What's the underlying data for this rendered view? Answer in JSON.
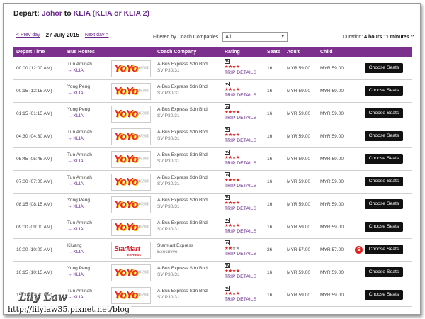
{
  "header": {
    "prefix": "Depart:",
    "origin": "Johor",
    "to": "to",
    "destination": "KLIA (KLIA or KLIA 2)"
  },
  "nav": {
    "prev": "< Prev day",
    "date": "27 July 2015",
    "next": "Next day >"
  },
  "filter": {
    "label": "Filtered by Coach Companies",
    "value": "All"
  },
  "duration": {
    "label": "Duration:",
    "value": "4 hours 11 minutes",
    "suffix": "**"
  },
  "columns": {
    "depart": "Depart Time",
    "routes": "Bus Routes",
    "company": "Coach Company",
    "rating": "Rating",
    "seats": "Seats",
    "adult": "Adult",
    "child": "Child"
  },
  "rows": [
    {
      "time": "00:00 (12:00 AM)",
      "from": "Tun Aminah",
      "to": "→ KLIA",
      "logo": "yoyo",
      "company": "A-Bus Express Sdn Bhd",
      "sub": "SVIP30/31",
      "stars": 4,
      "trip": "TRIP DETAILS",
      "seats": "16",
      "adult": "MYR 59.00",
      "child": "MYR 59.00",
      "badge": "",
      "button": "Choose Seats"
    },
    {
      "time": "00:15 (12:15 AM)",
      "from": "Yong Peng",
      "to": "→ KLIA",
      "logo": "yoyo",
      "company": "A-Bus Express Sdn Bhd",
      "sub": "SVIP30/31",
      "stars": 4,
      "trip": "TRIP DETAILS",
      "seats": "16",
      "adult": "MYR 59.00",
      "child": "MYR 59.00",
      "badge": "",
      "button": "Choose Seats"
    },
    {
      "time": "01:15 (01:15 AM)",
      "from": "Yong Peng",
      "to": "→ KLIA",
      "logo": "yoyo",
      "company": "A-Bus Express Sdn Bhd",
      "sub": "SVIP30/31",
      "stars": 4,
      "trip": "TRIP DETAILS",
      "seats": "16",
      "adult": "MYR 59.00",
      "child": "MYR 59.00",
      "badge": "",
      "button": "Choose Seats"
    },
    {
      "time": "04:30 (04:30 AM)",
      "from": "Tun Aminah",
      "to": "→ KLIA",
      "logo": "yoyo",
      "company": "A-Bus Express Sdn Bhd",
      "sub": "SVIP30/31",
      "stars": 4,
      "trip": "TRIP DETAILS",
      "seats": "16",
      "adult": "MYR 59.00",
      "child": "MYR 59.00",
      "badge": "",
      "button": "Choose Seats"
    },
    {
      "time": "05:45 (05:45 AM)",
      "from": "Tun Aminah",
      "to": "→ KLIA",
      "logo": "yoyo",
      "company": "A-Bus Express Sdn Bhd",
      "sub": "SVIP30/31",
      "stars": 4,
      "trip": "TRIP DETAILS",
      "seats": "16",
      "adult": "MYR 59.00",
      "child": "MYR 59.00",
      "badge": "",
      "button": "Choose Seats"
    },
    {
      "time": "07:00 (07:00 AM)",
      "from": "Tun Aminah",
      "to": "→ KLIA",
      "logo": "yoyo",
      "company": "A-Bus Express Sdn Bhd",
      "sub": "SVIP30/31",
      "stars": 4,
      "trip": "TRIP DETAILS",
      "seats": "16",
      "adult": "MYR 59.00",
      "child": "MYR 59.00",
      "badge": "",
      "button": "Choose Seats"
    },
    {
      "time": "08:15 (08:15 AM)",
      "from": "Yong Peng",
      "to": "→ KLIA",
      "logo": "yoyo",
      "company": "A-Bus Express Sdn Bhd",
      "sub": "SVIP30/31",
      "stars": 4,
      "trip": "TRIP DETAILS",
      "seats": "16",
      "adult": "MYR 59.00",
      "child": "MYR 59.00",
      "badge": "",
      "button": "Choose Seats"
    },
    {
      "time": "09:00 (09:00 AM)",
      "from": "Tun Aminah",
      "to": "→ KLIA",
      "logo": "yoyo",
      "company": "A-Bus Express Sdn Bhd",
      "sub": "SVIP30/31",
      "stars": 4,
      "trip": "TRIP DETAILS",
      "seats": "16",
      "adult": "MYR 59.00",
      "child": "MYR 59.00",
      "badge": "",
      "button": "Choose Seats"
    },
    {
      "time": "10:00 (10:00 AM)",
      "from": "Kluang",
      "to": "→ KLIA",
      "logo": "star",
      "company": "Starmart Express",
      "sub": "Executive",
      "stars": 2,
      "trip": "TRIP DETAILS",
      "seats": "26",
      "adult": "MYR 57.00",
      "child": "MYR 57.00",
      "badge": "S",
      "button": "Choose Seats"
    },
    {
      "time": "10:15 (10:15 AM)",
      "from": "Yong Peng",
      "to": "→ KLIA",
      "logo": "yoyo",
      "company": "A-Bus Express Sdn Bhd",
      "sub": "SVIP30/31",
      "stars": 4,
      "trip": "TRIP DETAILS",
      "seats": "16",
      "adult": "MYR 59.00",
      "child": "MYR 59.00",
      "badge": "",
      "button": "Choose Seats"
    },
    {
      "time": "15:00 (03:00 PM)",
      "from": "Tun Aminah",
      "to": "→ KLIA",
      "logo": "yoyo",
      "company": "A-Bus Express Sdn Bhd",
      "sub": "SVIP30/31",
      "stars": 4,
      "trip": "TRIP DETAILS",
      "seats": "16",
      "adult": "MYR 59.00",
      "child": "MYR 59.00",
      "badge": "",
      "button": "Choose Seats"
    }
  ],
  "logos": {
    "yoyo": "YoYo",
    "yoyo_tag": "快乐到家",
    "star": "StarMart",
    "star_tag": "EXPRESS"
  },
  "tv_icon": "TV",
  "watermark": {
    "name": "Lily Law",
    "url": "http://lilylaw35.pixnet.net/blog"
  },
  "colors": {
    "accent": "#7d2f8e",
    "link": "#6a2a8c",
    "star": "#e02020",
    "button": "#111111"
  }
}
